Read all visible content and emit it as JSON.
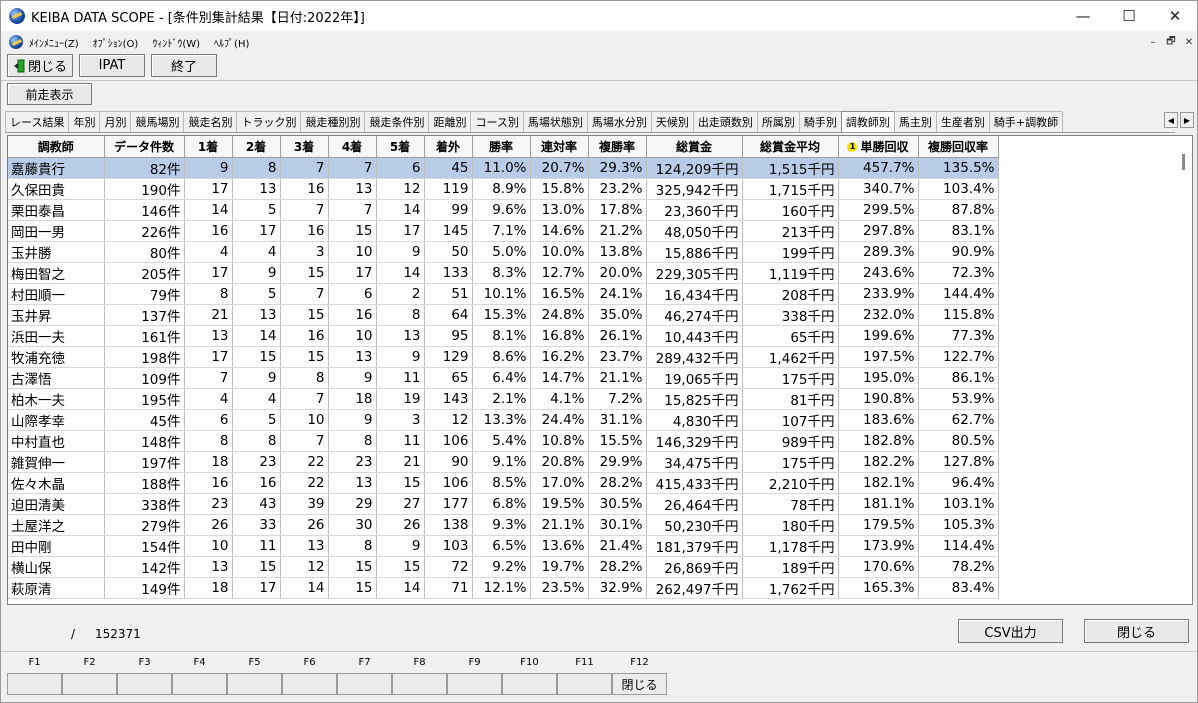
{
  "window": {
    "title": "KEIBA DATA SCOPE - [条件別集計結果【日付:2022年】]",
    "minimize": "—",
    "maximize": "☐",
    "close": "✕"
  },
  "menu": [
    "ﾒｲﾝﾒﾆｭｰ(Z)",
    "ｵﾌﾟｼｮﾝ(O)",
    "ｳｨﾝﾄﾞｳ(W)",
    "ﾍﾙﾌﾟ(H)"
  ],
  "mdi": {
    "minimize": "–",
    "restore": "🗗",
    "close": "✕"
  },
  "toolbar": {
    "close_label": "閉じる",
    "ipat_label": "IPAT",
    "end_label": "終了",
    "prev_label": "前走表示"
  },
  "tabs": [
    "レース結果",
    "年別",
    "月別",
    "競馬場別",
    "競走名別",
    "トラック別",
    "競走種別別",
    "競走条件別",
    "距離別",
    "コース別",
    "馬場状態別",
    "馬場水分別",
    "天候別",
    "出走頭数別",
    "所属別",
    "騎手別",
    "調教師別",
    "馬主別",
    "生産者別",
    "騎手+調教師"
  ],
  "active_tab": 16,
  "table": {
    "headers": [
      "調教師",
      "データ件数",
      "1着",
      "2着",
      "3着",
      "4着",
      "5着",
      "着外",
      "勝率",
      "連対率",
      "複勝率",
      "総賞金",
      "総賞金平均",
      "単勝回収",
      "複勝回収率"
    ],
    "sort_indicator": "1",
    "rows": [
      [
        "嘉藤貴行",
        "82件",
        "9",
        "8",
        "7",
        "7",
        "6",
        "45",
        "11.0%",
        "20.7%",
        "29.3%",
        "124,209千円",
        "1,515千円",
        "457.7%",
        "135.5%"
      ],
      [
        "久保田貴",
        "190件",
        "17",
        "13",
        "16",
        "13",
        "12",
        "119",
        "8.9%",
        "15.8%",
        "23.2%",
        "325,942千円",
        "1,715千円",
        "340.7%",
        "103.4%"
      ],
      [
        "栗田泰昌",
        "146件",
        "14",
        "5",
        "7",
        "7",
        "14",
        "99",
        "9.6%",
        "13.0%",
        "17.8%",
        "23,360千円",
        "160千円",
        "299.5%",
        "87.8%"
      ],
      [
        "岡田一男",
        "226件",
        "16",
        "17",
        "16",
        "15",
        "17",
        "145",
        "7.1%",
        "14.6%",
        "21.2%",
        "48,050千円",
        "213千円",
        "297.8%",
        "83.1%"
      ],
      [
        "玉井勝",
        "80件",
        "4",
        "4",
        "3",
        "10",
        "9",
        "50",
        "5.0%",
        "10.0%",
        "13.8%",
        "15,886千円",
        "199千円",
        "289.3%",
        "90.9%"
      ],
      [
        "梅田智之",
        "205件",
        "17",
        "9",
        "15",
        "17",
        "14",
        "133",
        "8.3%",
        "12.7%",
        "20.0%",
        "229,305千円",
        "1,119千円",
        "243.6%",
        "72.3%"
      ],
      [
        "村田順一",
        "79件",
        "8",
        "5",
        "7",
        "6",
        "2",
        "51",
        "10.1%",
        "16.5%",
        "24.1%",
        "16,434千円",
        "208千円",
        "233.9%",
        "144.4%"
      ],
      [
        "玉井昇",
        "137件",
        "21",
        "13",
        "15",
        "16",
        "8",
        "64",
        "15.3%",
        "24.8%",
        "35.0%",
        "46,274千円",
        "338千円",
        "232.0%",
        "115.8%"
      ],
      [
        "浜田一夫",
        "161件",
        "13",
        "14",
        "16",
        "10",
        "13",
        "95",
        "8.1%",
        "16.8%",
        "26.1%",
        "10,443千円",
        "65千円",
        "199.6%",
        "77.3%"
      ],
      [
        "牧浦充徳",
        "198件",
        "17",
        "15",
        "15",
        "13",
        "9",
        "129",
        "8.6%",
        "16.2%",
        "23.7%",
        "289,432千円",
        "1,462千円",
        "197.5%",
        "122.7%"
      ],
      [
        "古澤悟",
        "109件",
        "7",
        "9",
        "8",
        "9",
        "11",
        "65",
        "6.4%",
        "14.7%",
        "21.1%",
        "19,065千円",
        "175千円",
        "195.0%",
        "86.1%"
      ],
      [
        "柏木一夫",
        "195件",
        "4",
        "4",
        "7",
        "18",
        "19",
        "143",
        "2.1%",
        "4.1%",
        "7.2%",
        "15,825千円",
        "81千円",
        "190.8%",
        "53.9%"
      ],
      [
        "山際孝幸",
        "45件",
        "6",
        "5",
        "10",
        "9",
        "3",
        "12",
        "13.3%",
        "24.4%",
        "31.1%",
        "4,830千円",
        "107千円",
        "183.6%",
        "62.7%"
      ],
      [
        "中村直也",
        "148件",
        "8",
        "8",
        "7",
        "8",
        "11",
        "106",
        "5.4%",
        "10.8%",
        "15.5%",
        "146,329千円",
        "989千円",
        "182.8%",
        "80.5%"
      ],
      [
        "雑賀伸一",
        "197件",
        "18",
        "23",
        "22",
        "23",
        "21",
        "90",
        "9.1%",
        "20.8%",
        "29.9%",
        "34,475千円",
        "175千円",
        "182.2%",
        "127.8%"
      ],
      [
        "佐々木晶",
        "188件",
        "16",
        "16",
        "22",
        "13",
        "15",
        "106",
        "8.5%",
        "17.0%",
        "28.2%",
        "415,433千円",
        "2,210千円",
        "182.1%",
        "96.4%"
      ],
      [
        "迫田清美",
        "338件",
        "23",
        "43",
        "39",
        "29",
        "27",
        "177",
        "6.8%",
        "19.5%",
        "30.5%",
        "26,464千円",
        "78千円",
        "181.1%",
        "103.1%"
      ],
      [
        "土屋洋之",
        "279件",
        "26",
        "33",
        "26",
        "30",
        "26",
        "138",
        "9.3%",
        "21.1%",
        "30.1%",
        "50,230千円",
        "180千円",
        "179.5%",
        "105.3%"
      ],
      [
        "田中剛",
        "154件",
        "10",
        "11",
        "13",
        "8",
        "9",
        "103",
        "6.5%",
        "13.6%",
        "21.4%",
        "181,379千円",
        "1,178千円",
        "173.9%",
        "114.4%"
      ],
      [
        "横山保",
        "142件",
        "13",
        "15",
        "12",
        "15",
        "15",
        "72",
        "9.2%",
        "19.7%",
        "28.2%",
        "26,869千円",
        "189千円",
        "170.6%",
        "78.2%"
      ],
      [
        "萩原清",
        "149件",
        "18",
        "17",
        "14",
        "15",
        "14",
        "71",
        "12.1%",
        "23.5%",
        "32.9%",
        "262,497千円",
        "1,762千円",
        "165.3%",
        "83.4%"
      ]
    ]
  },
  "status": {
    "slash": "/",
    "total": "152371",
    "csv_label": "CSV出力",
    "close_label": "閉じる"
  },
  "fkeys": [
    {
      "key": "F1",
      "label": ""
    },
    {
      "key": "F2",
      "label": ""
    },
    {
      "key": "F3",
      "label": ""
    },
    {
      "key": "F4",
      "label": ""
    },
    {
      "key": "F5",
      "label": ""
    },
    {
      "key": "F6",
      "label": ""
    },
    {
      "key": "F7",
      "label": ""
    },
    {
      "key": "F8",
      "label": ""
    },
    {
      "key": "F9",
      "label": ""
    },
    {
      "key": "F10",
      "label": ""
    },
    {
      "key": "F11",
      "label": ""
    },
    {
      "key": "F12",
      "label": "閉じる"
    }
  ]
}
